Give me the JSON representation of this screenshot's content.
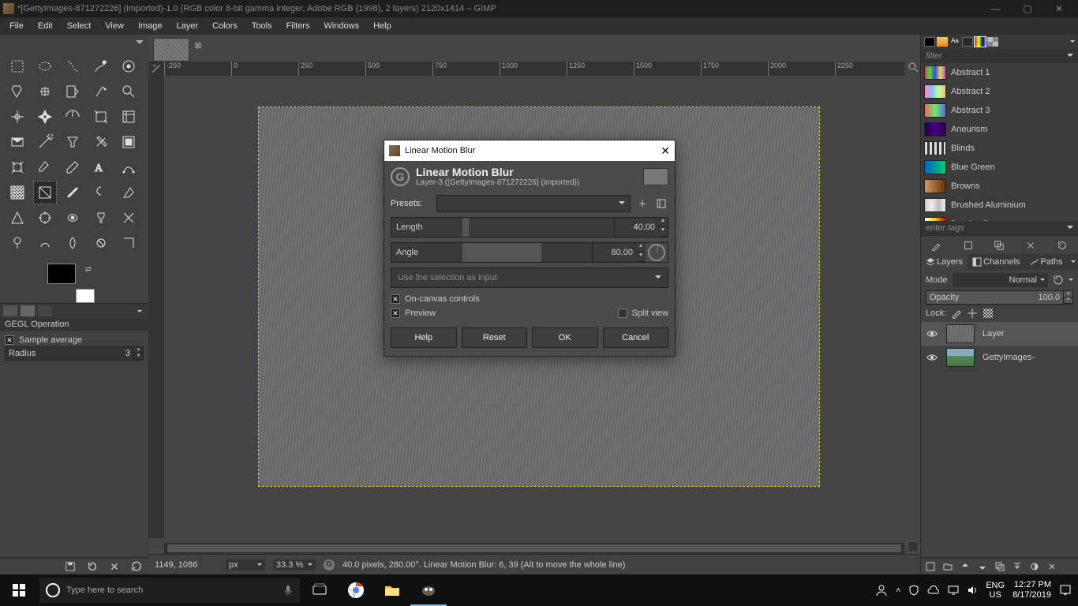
{
  "titlebar": {
    "title": "*[GettyImages-871272226] (imported)-1.0 (RGB color 8-bit gamma integer, Adobe RGB (1998), 2 layers) 2120x1414 – GIMP"
  },
  "menu": [
    "File",
    "Edit",
    "Select",
    "View",
    "Image",
    "Layer",
    "Colors",
    "Tools",
    "Filters",
    "Windows",
    "Help"
  ],
  "tool_options": {
    "title": "GEGL Operation",
    "sample_average": "Sample average",
    "radius_label": "Radius",
    "radius_value": "3"
  },
  "ruler_ticks": [
    "-250",
    "0",
    "250",
    "500",
    "750",
    "1000",
    "1250",
    "1500",
    "1750",
    "2000",
    "2250"
  ],
  "status": {
    "coords": "1149, 1086",
    "unit": "px",
    "zoom": "33.3 %",
    "msg": "40.0 pixels, 280.00°. Linear Motion Blur: 6, 39 (Alt to move the whole line)"
  },
  "dialog": {
    "window_title": "Linear Motion Blur",
    "title": "Linear Motion Blur",
    "subtitle": "Layer-3 ([GettyImages-871272226] (imported))",
    "presets_label": "Presets:",
    "length_label": "Length",
    "length_value": "40.00",
    "angle_label": "Angle",
    "angle_value": "80.00",
    "selection_input": "Use the selection as input",
    "oncanvas": "On-canvas controls",
    "preview": "Preview",
    "splitview": "Split view",
    "btn_help": "Help",
    "btn_reset": "Reset",
    "btn_ok": "OK",
    "btn_cancel": "Cancel"
  },
  "right": {
    "filter_placeholder": "filter",
    "gradients": [
      {
        "name": "Abstract 1",
        "css": "linear-gradient(90deg,#d44,#4d4,#44d,#dd4,#d4d)"
      },
      {
        "name": "Abstract 2",
        "css": "linear-gradient(90deg,#f8b,#8bf,#bf8,#fb8)"
      },
      {
        "name": "Abstract 3",
        "css": "linear-gradient(90deg,#e66,#6e6,#66e)"
      },
      {
        "name": "Aneurism",
        "css": "linear-gradient(90deg,#204,#408,#204)"
      },
      {
        "name": "Blinds",
        "css": "repeating-linear-gradient(90deg,#ddd 0,#ddd 3px,#333 3px,#333 6px)"
      },
      {
        "name": "Blue Green",
        "css": "linear-gradient(90deg,#06c,#0c6)"
      },
      {
        "name": "Browns",
        "css": "linear-gradient(90deg,#c96,#963,#630)"
      },
      {
        "name": "Brushed Aluminium",
        "css": "linear-gradient(90deg,#ccc,#eee,#bbb,#eee)"
      },
      {
        "name": "Burning Paper",
        "css": "linear-gradient(90deg,#fff,#fc0,#c00)"
      }
    ],
    "enter_tags": "enter tags",
    "tabs": {
      "layers": "Layers",
      "channels": "Channels",
      "paths": "Paths"
    },
    "mode_label": "Mode",
    "mode_value": "Normal",
    "opacity_label": "Opacity",
    "opacity_value": "100.0",
    "lock_label": "Lock:",
    "layers": [
      {
        "name": "Layer",
        "sel": true,
        "thumb_css": "repeating-linear-gradient(98deg,#5f5f5f 0,#787878 2px,#5f5f5f 4px)"
      },
      {
        "name": "GettyImages-",
        "sel": false,
        "thumb_css": "linear-gradient(#8ab 0%,#8ab 40%,#586 40%,#473 100%)"
      }
    ]
  },
  "taskbar": {
    "search_placeholder": "Type here to search",
    "lang1": "ENG",
    "lang2": "US",
    "time": "12:27 PM",
    "date": "8/17/2019"
  }
}
